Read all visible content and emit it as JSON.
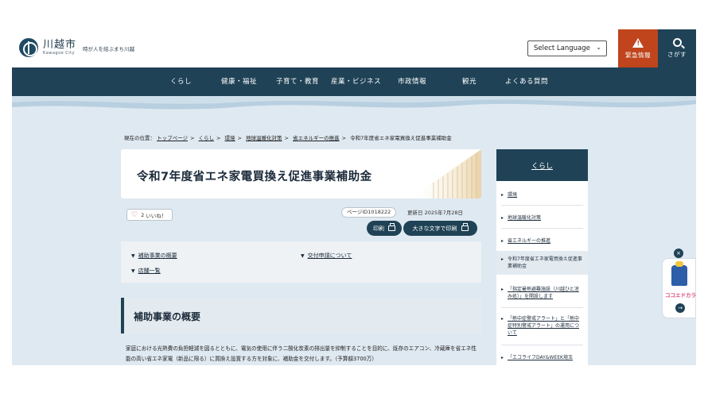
{
  "header": {
    "logo_name": "川越市",
    "logo_en": "Kawagoe City",
    "tagline": "時が人を結ぶまち川越",
    "language_label": "Select Language",
    "emergency_label": "緊急情報",
    "search_label": "さがす"
  },
  "nav": {
    "items": [
      "くらし",
      "健康・福祉",
      "子育て・教育",
      "産業・ビジネス",
      "市政情報",
      "観光",
      "よくある質問"
    ]
  },
  "breadcrumb": {
    "prefix": "現在の位置：",
    "items": [
      "トップページ",
      "くらし",
      "環境",
      "地球温暖化対策",
      "省エネルギーの推進"
    ],
    "current": "令和7年度省エネ家電買換え促進事業補助金",
    "separator": ">"
  },
  "page": {
    "title": "令和7年度省エネ家電買換え促進事業補助金",
    "like_count": "2",
    "like_label": "いいね！",
    "page_id": "ページID1018222",
    "updated": "更新日 2025年7月28日",
    "print_label": "印刷",
    "large_print_label": "大きな文字で印刷"
  },
  "toc": {
    "items": [
      "補助事業の概要",
      "交付申請について",
      "店舗一覧"
    ]
  },
  "section": {
    "heading": "補助事業の概要",
    "body": "家庭における光熱費の負担軽減を図るとともに、電気の使用に伴う二酸化炭素の排出量を抑制することを目的に、既存のエアコン、冷蔵庫を省エネ性能の高い省エネ家電（新品に限る）に買換え設置する方を対象に、補助金を交付します。（予算額3700万）"
  },
  "sidebar": {
    "heading": "くらし",
    "items": [
      "環境",
      "地球温暖化対策",
      "省エネルギーの推進",
      "令和7年度省エネ家電買換え促進事業補助金",
      "「指定暑熱避難施設（川越ひと涼み処）」を開設します",
      "「熱中症警戒アラート」と「熱中症特別警戒アラート」の運用について",
      "「エコライフDAY&WEEK埼玉"
    ]
  },
  "widget": {
    "label": "ココエドカラー"
  },
  "colors": {
    "navy": "#1f4256",
    "emergency": "#c0451c",
    "background": "#dfe9f1"
  }
}
